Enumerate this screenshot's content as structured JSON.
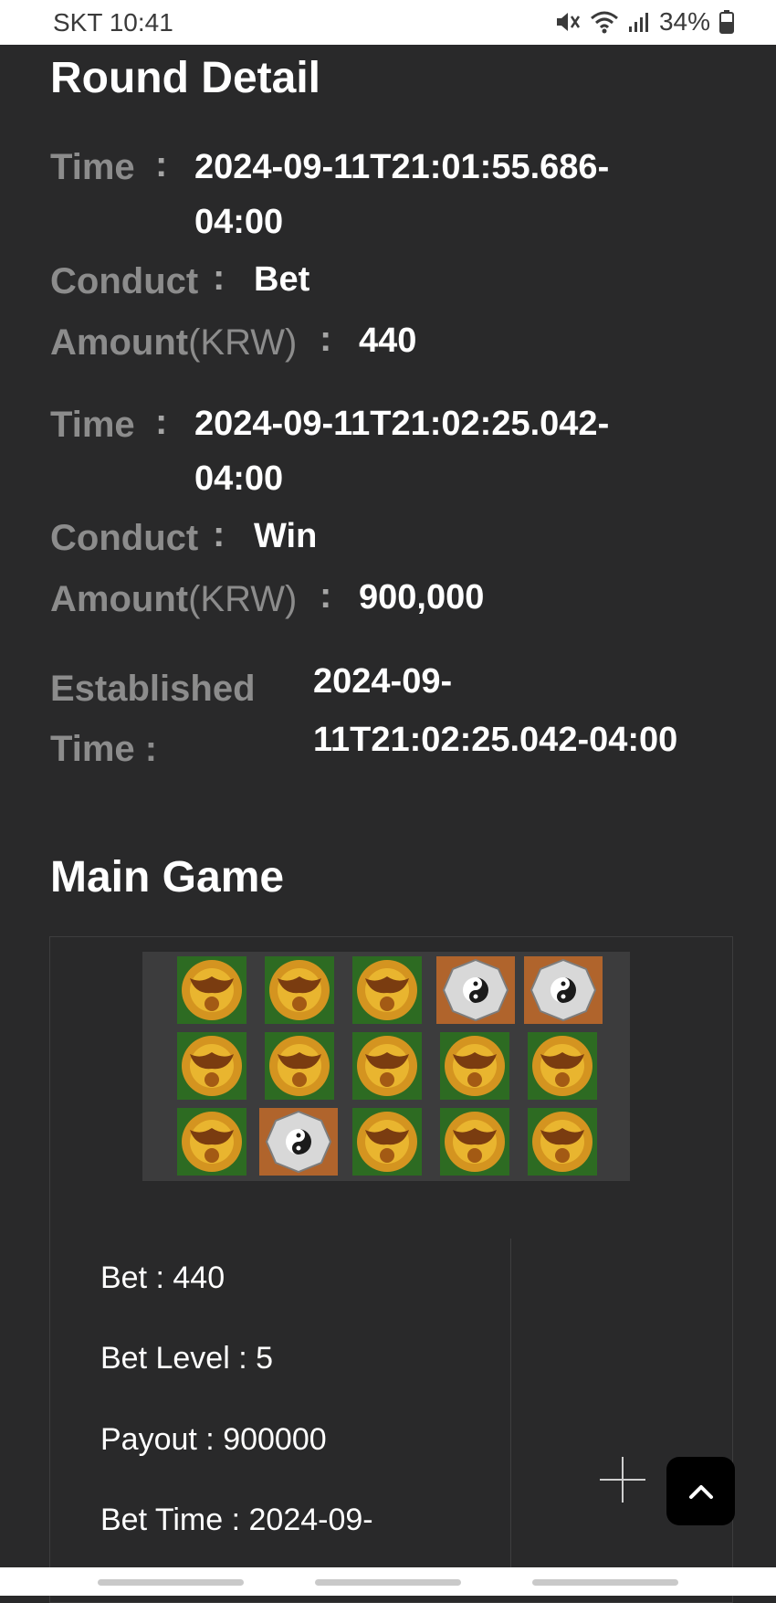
{
  "status_bar": {
    "carrier_time": "SKT 10:41",
    "battery": "34%"
  },
  "round_detail": {
    "title": "Round Detail",
    "entries": [
      {
        "time_label": "Time",
        "time_line1": "2024-09-11T21:01:55.686-",
        "time_line2": "04:00",
        "conduct_label": "Conduct",
        "conduct": "Bet",
        "amount_label": "Amount",
        "amount_unit": "(KRW)",
        "amount": "440"
      },
      {
        "time_label": "Time",
        "time_line1": "2024-09-11T21:02:25.042-",
        "time_line2": "04:00",
        "conduct_label": "Conduct",
        "conduct": "Win",
        "amount_label": "Amount",
        "amount_unit": "(KRW)",
        "amount": "900,000"
      }
    ],
    "established": {
      "label_line1": "Established",
      "label_line2": "Time :",
      "value_line1": "2024-09-",
      "value_line2": "11T21:02:25.042-04:00"
    }
  },
  "main_game": {
    "title": "Main Game",
    "reels": [
      [
        "bat-coin-icon",
        "bat-coin-icon",
        "bat-coin-icon",
        "bagua-icon",
        "bagua-icon"
      ],
      [
        "bat-coin-icon",
        "bat-coin-icon",
        "bat-coin-icon",
        "bat-coin-icon",
        "bat-coin-icon"
      ],
      [
        "bat-coin-icon",
        "bagua-icon",
        "bat-coin-icon",
        "bat-coin-icon",
        "bat-coin-icon"
      ]
    ],
    "info": {
      "bet": "Bet : 440",
      "bet_level": "Bet Level : 5",
      "payout": "Payout : 900000",
      "bet_time": "Bet Time : 2024-09-"
    }
  },
  "colors": {
    "background": "#29292a",
    "label": "#8c8c8c",
    "value": "#ffffff"
  }
}
